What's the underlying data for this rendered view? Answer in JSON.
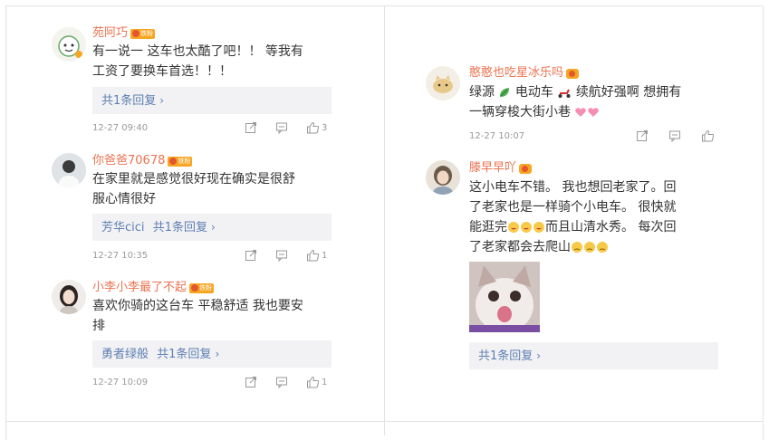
{
  "left_column": {
    "comments": [
      {
        "name": "苑阿巧",
        "badge": "铁粉",
        "text_line1": "有一说一 这车也太酷了吧！！ 等我有",
        "text_line2": "工资了要换车首选！！！",
        "reply_label": "共1条回复",
        "time": "12-27 09:40",
        "like_count": "3"
      },
      {
        "name": "你爸爸70678",
        "badge": "铁粉",
        "text_line1": "在家里就是感觉很好现在确实是很舒",
        "text_line2": "服心情很好",
        "reply_user": "芳华cici",
        "reply_label": "共1条回复",
        "time": "12-27 10:35",
        "like_count": "1"
      },
      {
        "name": "小李小李最了不起",
        "badge": "铁粉",
        "text_line1": "喜欢你骑的这台车 平稳舒适 我也要安",
        "text_line2": "排",
        "reply_user": "勇者绿般",
        "reply_label": "共1条回复",
        "time": "12-27 10:09",
        "like_count": "1"
      }
    ]
  },
  "right_column": {
    "comments": [
      {
        "name": "憨憨也吃星冰乐吗",
        "text_line1_a": "绿源",
        "text_line1_b": "电动车",
        "text_line1_c": "续航好强啊 想拥有",
        "text_line2": "一辆穿梭大街小巷",
        "time": "12-27 10:07",
        "like_count": ""
      },
      {
        "name": "滕早早吖",
        "text_line1": "这小电车不错。 我也想回老家了。回",
        "text_line2": "了老家也是一样骑个小电车。 很快就",
        "text_line3_a": "能逛完",
        "text_line3_b": "而且山清水秀。 每次回",
        "text_line4": "了老家都会去爬山",
        "reply_label": "共1条回复"
      }
    ]
  },
  "colors": {
    "name": "#eb7350",
    "link": "#5d7fb1",
    "reply_bg": "#f2f2f5",
    "meta": "#999999"
  },
  "icons": [
    "share-icon",
    "comment-icon",
    "like-icon",
    "chevron-right-icon"
  ]
}
